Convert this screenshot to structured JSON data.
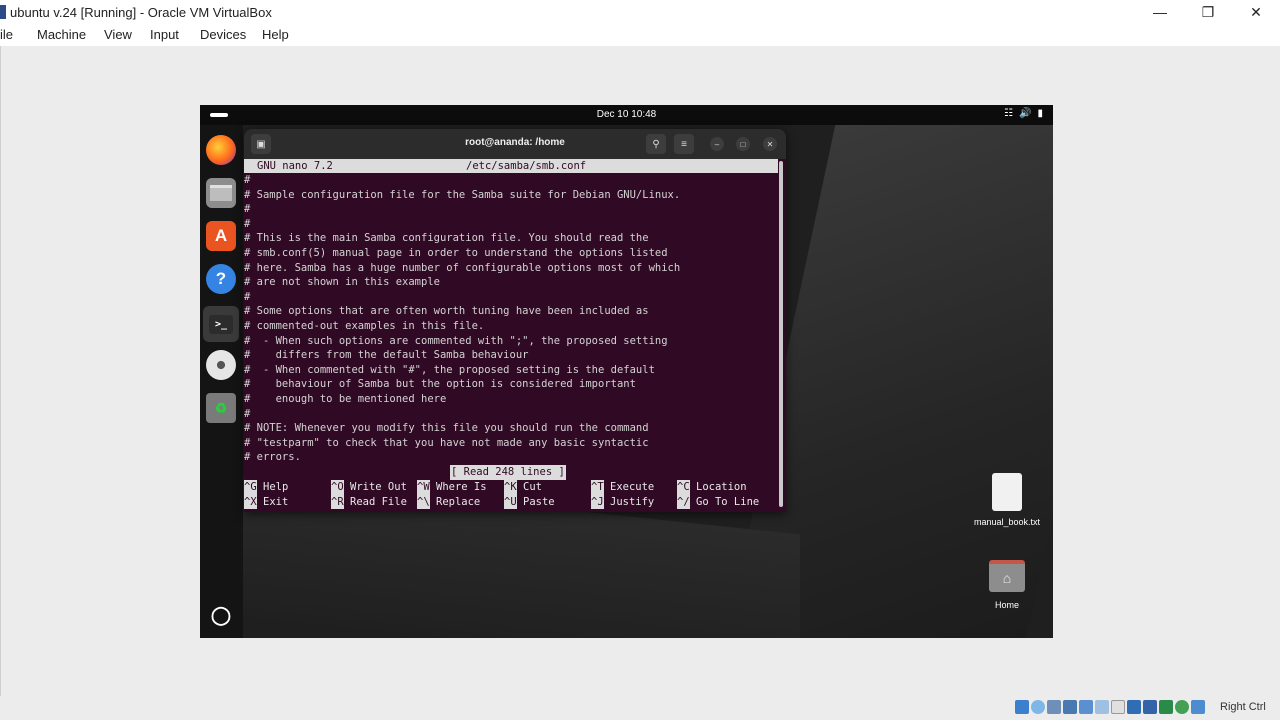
{
  "vbox": {
    "title": "ubuntu v.24 [Running] - Oracle VM VirtualBox",
    "menu": [
      "File",
      "Machine",
      "View",
      "Input",
      "Devices",
      "Help"
    ],
    "host_key": "Right Ctrl"
  },
  "guest": {
    "clock": "Dec 10  10:48",
    "dock": [
      {
        "name": "Firefox",
        "icon": "firefox-icon"
      },
      {
        "name": "Files",
        "icon": "files-icon"
      },
      {
        "name": "App Center",
        "icon": "app-center-icon"
      },
      {
        "name": "Help",
        "icon": "help-icon"
      },
      {
        "name": "Terminal",
        "icon": "terminal-icon"
      },
      {
        "name": "Disc",
        "icon": "disc-icon"
      },
      {
        "name": "Trash",
        "icon": "trash-icon"
      }
    ],
    "desktop_icons": [
      {
        "label": "manual_book.txt",
        "icon": "text-file-icon"
      },
      {
        "label": "Home",
        "icon": "home-folder-icon"
      }
    ]
  },
  "terminal": {
    "title": "root@ananda: /home",
    "nano": {
      "version": "GNU nano 7.2",
      "filename": "/etc/samba/smb.conf",
      "lines": [
        "#",
        "# Sample configuration file for the Samba suite for Debian GNU/Linux.",
        "#",
        "#",
        "# This is the main Samba configuration file. You should read the",
        "# smb.conf(5) manual page in order to understand the options listed",
        "# here. Samba has a huge number of configurable options most of which",
        "# are not shown in this example",
        "#",
        "# Some options that are often worth tuning have been included as",
        "# commented-out examples in this file.",
        "#  - When such options are commented with \";\", the proposed setting",
        "#    differs from the default Samba behaviour",
        "#  - When commented with \"#\", the proposed setting is the default",
        "#    behaviour of Samba but the option is considered important",
        "#    enough to be mentioned here",
        "#",
        "# NOTE: Whenever you modify this file you should run the command",
        "# \"testparm\" to check that you have not made any basic syntactic",
        "# errors."
      ],
      "status": "[ Read 248 lines ]",
      "shortcuts_row1": [
        {
          "key": "^G",
          "label": "Help"
        },
        {
          "key": "^O",
          "label": "Write Out"
        },
        {
          "key": "^W",
          "label": "Where Is"
        },
        {
          "key": "^K",
          "label": "Cut"
        },
        {
          "key": "^T",
          "label": "Execute"
        },
        {
          "key": "^C",
          "label": "Location"
        }
      ],
      "shortcuts_row2": [
        {
          "key": "^X",
          "label": "Exit"
        },
        {
          "key": "^R",
          "label": "Read File"
        },
        {
          "key": "^\\",
          "label": "Replace"
        },
        {
          "key": "^U",
          "label": "Paste"
        },
        {
          "key": "^J",
          "label": "Justify"
        },
        {
          "key": "^/",
          "label": "Go To Line"
        }
      ]
    }
  },
  "colors": {
    "terminal_bg": "#300a24",
    "nano_bar": "#dcdcdc"
  }
}
